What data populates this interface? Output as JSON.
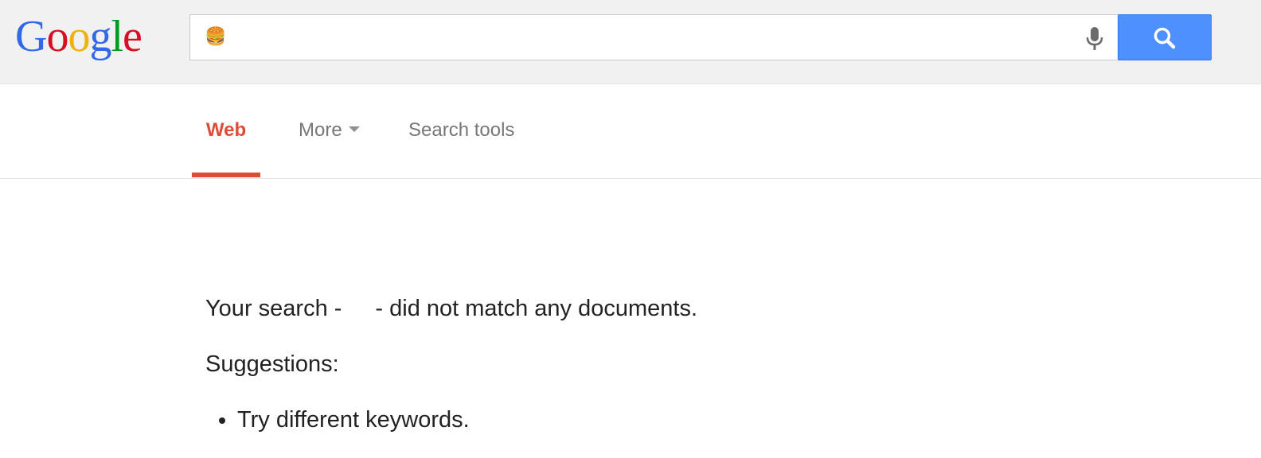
{
  "logo": {
    "letters": [
      "G",
      "o",
      "o",
      "g",
      "l",
      "e"
    ],
    "colors": [
      "#3369e8",
      "#d50f25",
      "#eeb211",
      "#3369e8",
      "#009925",
      "#d50f25"
    ]
  },
  "search": {
    "value": "🍔",
    "button_icon": "search-icon",
    "voice_icon": "microphone-icon",
    "button_color": "#4d90fe"
  },
  "tabs": [
    {
      "label": "Web",
      "active": true,
      "color": "#dd4b39"
    },
    {
      "label": "More",
      "has_caret": true
    },
    {
      "label": "Search tools"
    }
  ],
  "results": {
    "message_prefix": "Your search -",
    "message_suffix": "- did not match any documents.",
    "suggestions_title": "Suggestions:",
    "suggestions": [
      "Try different keywords."
    ]
  }
}
